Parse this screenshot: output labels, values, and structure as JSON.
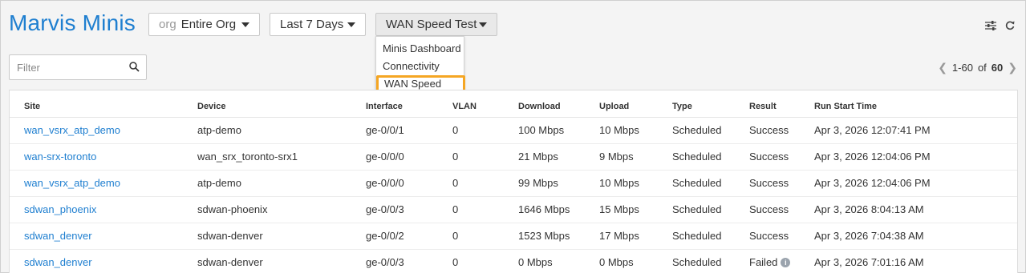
{
  "header": {
    "title": "Marvis Minis",
    "org_dropdown": {
      "prefix": "org",
      "value": "Entire Org"
    },
    "range_dropdown": {
      "value": "Last 7 Days"
    },
    "view_dropdown": {
      "value": "WAN Speed Test"
    },
    "view_menu": {
      "items": [
        "Minis Dashboard",
        "Connectivity",
        "WAN Speed Test"
      ],
      "selected": "WAN Speed Test"
    },
    "icons": [
      "settings-sliders-icon",
      "refresh-icon"
    ]
  },
  "filter": {
    "placeholder": "Filter",
    "value": ""
  },
  "pager": {
    "range": "1-60",
    "of_label": "of",
    "total": "60"
  },
  "table": {
    "columns": [
      "Site",
      "Device",
      "Interface",
      "VLAN",
      "Download",
      "Upload",
      "Type",
      "Result",
      "Run Start Time"
    ],
    "rows": [
      {
        "site": "wan_vsrx_atp_demo",
        "device": "atp-demo",
        "interface": "ge-0/0/1",
        "vlan": "0",
        "download": "100 Mbps",
        "upload": "10 Mbps",
        "type": "Scheduled",
        "result": "Success",
        "time": "Apr 3, 2026 12:07:41 PM"
      },
      {
        "site": "wan-srx-toronto",
        "device": "wan_srx_toronto-srx1",
        "interface": "ge-0/0/0",
        "vlan": "0",
        "download": "21 Mbps",
        "upload": "9 Mbps",
        "type": "Scheduled",
        "result": "Success",
        "time": "Apr 3, 2026 12:04:06 PM"
      },
      {
        "site": "wan_vsrx_atp_demo",
        "device": "atp-demo",
        "interface": "ge-0/0/0",
        "vlan": "0",
        "download": "99 Mbps",
        "upload": "10 Mbps",
        "type": "Scheduled",
        "result": "Success",
        "time": "Apr 3, 2026 12:04:06 PM"
      },
      {
        "site": "sdwan_phoenix",
        "device": "sdwan-phoenix",
        "interface": "ge-0/0/3",
        "vlan": "0",
        "download": "1646 Mbps",
        "upload": "15 Mbps",
        "type": "Scheduled",
        "result": "Success",
        "time": "Apr 3, 2026 8:04:13 AM"
      },
      {
        "site": "sdwan_denver",
        "device": "sdwan-denver",
        "interface": "ge-0/0/2",
        "vlan": "0",
        "download": "1523 Mbps",
        "upload": "17 Mbps",
        "type": "Scheduled",
        "result": "Success",
        "time": "Apr 3, 2026 7:04:38 AM"
      },
      {
        "site": "sdwan_denver",
        "device": "sdwan-denver",
        "interface": "ge-0/0/3",
        "vlan": "0",
        "download": "0 Mbps",
        "upload": "0 Mbps",
        "type": "Scheduled",
        "result": "Failed",
        "time": "Apr 3, 2026 7:01:16 AM",
        "result_info_icon": true
      }
    ]
  },
  "colors": {
    "accent": "#1f7fd0",
    "highlight": "#f5a623",
    "background": "#f4f4f4"
  }
}
